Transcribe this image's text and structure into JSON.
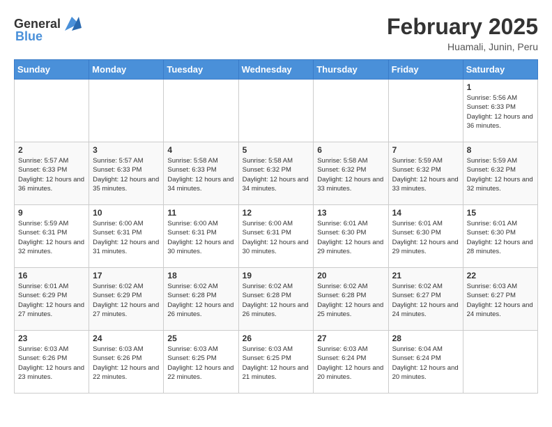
{
  "header": {
    "logo_general": "General",
    "logo_blue": "Blue",
    "month_year": "February 2025",
    "location": "Huamali, Junin, Peru"
  },
  "weekdays": [
    "Sunday",
    "Monday",
    "Tuesday",
    "Wednesday",
    "Thursday",
    "Friday",
    "Saturday"
  ],
  "weeks": [
    [
      {
        "day": "",
        "info": ""
      },
      {
        "day": "",
        "info": ""
      },
      {
        "day": "",
        "info": ""
      },
      {
        "day": "",
        "info": ""
      },
      {
        "day": "",
        "info": ""
      },
      {
        "day": "",
        "info": ""
      },
      {
        "day": "1",
        "info": "Sunrise: 5:56 AM\nSunset: 6:33 PM\nDaylight: 12 hours and 36 minutes."
      }
    ],
    [
      {
        "day": "2",
        "info": "Sunrise: 5:57 AM\nSunset: 6:33 PM\nDaylight: 12 hours and 36 minutes."
      },
      {
        "day": "3",
        "info": "Sunrise: 5:57 AM\nSunset: 6:33 PM\nDaylight: 12 hours and 35 minutes."
      },
      {
        "day": "4",
        "info": "Sunrise: 5:58 AM\nSunset: 6:33 PM\nDaylight: 12 hours and 34 minutes."
      },
      {
        "day": "5",
        "info": "Sunrise: 5:58 AM\nSunset: 6:32 PM\nDaylight: 12 hours and 34 minutes."
      },
      {
        "day": "6",
        "info": "Sunrise: 5:58 AM\nSunset: 6:32 PM\nDaylight: 12 hours and 33 minutes."
      },
      {
        "day": "7",
        "info": "Sunrise: 5:59 AM\nSunset: 6:32 PM\nDaylight: 12 hours and 33 minutes."
      },
      {
        "day": "8",
        "info": "Sunrise: 5:59 AM\nSunset: 6:32 PM\nDaylight: 12 hours and 32 minutes."
      }
    ],
    [
      {
        "day": "9",
        "info": "Sunrise: 5:59 AM\nSunset: 6:31 PM\nDaylight: 12 hours and 32 minutes."
      },
      {
        "day": "10",
        "info": "Sunrise: 6:00 AM\nSunset: 6:31 PM\nDaylight: 12 hours and 31 minutes."
      },
      {
        "day": "11",
        "info": "Sunrise: 6:00 AM\nSunset: 6:31 PM\nDaylight: 12 hours and 30 minutes."
      },
      {
        "day": "12",
        "info": "Sunrise: 6:00 AM\nSunset: 6:31 PM\nDaylight: 12 hours and 30 minutes."
      },
      {
        "day": "13",
        "info": "Sunrise: 6:01 AM\nSunset: 6:30 PM\nDaylight: 12 hours and 29 minutes."
      },
      {
        "day": "14",
        "info": "Sunrise: 6:01 AM\nSunset: 6:30 PM\nDaylight: 12 hours and 29 minutes."
      },
      {
        "day": "15",
        "info": "Sunrise: 6:01 AM\nSunset: 6:30 PM\nDaylight: 12 hours and 28 minutes."
      }
    ],
    [
      {
        "day": "16",
        "info": "Sunrise: 6:01 AM\nSunset: 6:29 PM\nDaylight: 12 hours and 27 minutes."
      },
      {
        "day": "17",
        "info": "Sunrise: 6:02 AM\nSunset: 6:29 PM\nDaylight: 12 hours and 27 minutes."
      },
      {
        "day": "18",
        "info": "Sunrise: 6:02 AM\nSunset: 6:28 PM\nDaylight: 12 hours and 26 minutes."
      },
      {
        "day": "19",
        "info": "Sunrise: 6:02 AM\nSunset: 6:28 PM\nDaylight: 12 hours and 26 minutes."
      },
      {
        "day": "20",
        "info": "Sunrise: 6:02 AM\nSunset: 6:28 PM\nDaylight: 12 hours and 25 minutes."
      },
      {
        "day": "21",
        "info": "Sunrise: 6:02 AM\nSunset: 6:27 PM\nDaylight: 12 hours and 24 minutes."
      },
      {
        "day": "22",
        "info": "Sunrise: 6:03 AM\nSunset: 6:27 PM\nDaylight: 12 hours and 24 minutes."
      }
    ],
    [
      {
        "day": "23",
        "info": "Sunrise: 6:03 AM\nSunset: 6:26 PM\nDaylight: 12 hours and 23 minutes."
      },
      {
        "day": "24",
        "info": "Sunrise: 6:03 AM\nSunset: 6:26 PM\nDaylight: 12 hours and 22 minutes."
      },
      {
        "day": "25",
        "info": "Sunrise: 6:03 AM\nSunset: 6:25 PM\nDaylight: 12 hours and 22 minutes."
      },
      {
        "day": "26",
        "info": "Sunrise: 6:03 AM\nSunset: 6:25 PM\nDaylight: 12 hours and 21 minutes."
      },
      {
        "day": "27",
        "info": "Sunrise: 6:03 AM\nSunset: 6:24 PM\nDaylight: 12 hours and 20 minutes."
      },
      {
        "day": "28",
        "info": "Sunrise: 6:04 AM\nSunset: 6:24 PM\nDaylight: 12 hours and 20 minutes."
      },
      {
        "day": "",
        "info": ""
      }
    ]
  ]
}
